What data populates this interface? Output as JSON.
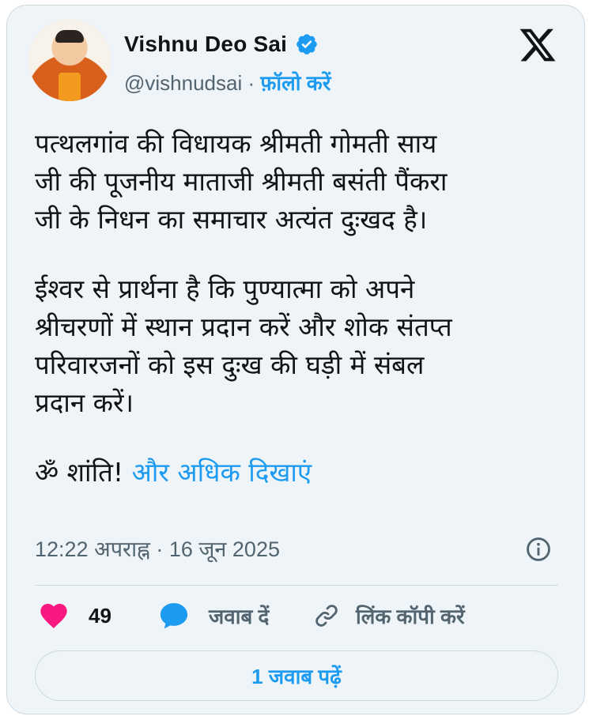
{
  "tweet": {
    "author_name": "Vishnu Deo Sai",
    "handle": "@vishnudsai",
    "separator": " · ",
    "follow_label": "फ़ॉलो करें",
    "paragraph1": "पत्थलगांव की विधायक श्रीमती गोमती साय\nजी की पूजनीय माताजी श्रीमती बसंती पैंकरा\nजी के निधन का समाचार अत्यंत दुःखद है।",
    "paragraph2": "ईश्वर से प्रार्थना है कि पुण्यात्मा को अपने\nश्रीचरणों में स्थान प्रदान करें और शोक संतप्त\nपरिवारजनों को इस दुःख की घड़ी में संबल\nप्रदान करें।",
    "paragraph3": "ॐ शांति! ",
    "show_more": "और अधिक दिखाएं",
    "timestamp": "12:22 अपराह्न · 16 जून 2025"
  },
  "actions": {
    "like_count": "49",
    "reply_label": "जवाब दें",
    "copy_link_label": "लिंक कॉपी करें"
  },
  "read_replies_label": "1 जवाब पढ़ें",
  "icons": {
    "verified": "verified-badge-icon",
    "logo": "x-logo-icon",
    "info": "info-icon",
    "like": "heart-icon",
    "reply": "speech-bubble-icon",
    "link": "link-icon"
  },
  "colors": {
    "accent": "#1d9bf0",
    "like": "#f91880",
    "muted": "#536471",
    "background": "#eef4f7"
  }
}
